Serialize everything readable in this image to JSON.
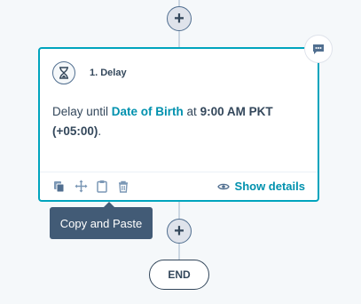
{
  "workflow": {
    "add_step_symbol": "+",
    "end_label": "END",
    "action": {
      "title": "1. Delay",
      "description_prefix": "Delay until ",
      "property": "Date of Birth",
      "description_middle": " at ",
      "time": "9:00 AM PKT",
      "timezone": "(+05:00)",
      "description_suffix": ".",
      "show_details_label": "Show details"
    },
    "tooltip": "Copy and Paste",
    "icons": {
      "comment": "comment-icon",
      "hourglass": "hourglass-icon",
      "clone": "clone-icon",
      "move": "move-icon",
      "copy_paste": "clipboard-icon",
      "delete": "trash-icon",
      "view": "eye-icon"
    },
    "colors": {
      "accent": "#00a4bd",
      "link": "#0091ae",
      "text": "#33475b",
      "tooltip_bg": "#425b76",
      "background": "#f5f8fa"
    }
  }
}
